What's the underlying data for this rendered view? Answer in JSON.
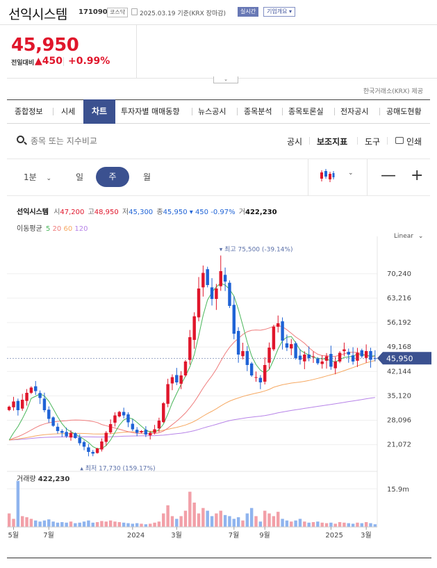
{
  "header": {
    "name": "선익시스템",
    "code": "171090",
    "market": "코스닥",
    "date": "2025.03.19",
    "date_suffix": "기준(KRX 장마감)",
    "realtime": "실시간",
    "corp_info": "기업개요",
    "corp_caret": "▾"
  },
  "quote": {
    "price": "45,950",
    "prev_label": "전일대비",
    "change": "▲450",
    "change_pct": "+0.99%",
    "collapse": "⌄"
  },
  "provider": "한국거래소(KRX) 제공",
  "tabs": [
    "종합정보",
    "시세",
    "차트",
    "투자자별 매매동향",
    "뉴스공시",
    "종목분석",
    "종목토론실",
    "전자공시",
    "공매도현황"
  ],
  "toolbar": {
    "search_placeholder": "종목 또는 지수비교",
    "disclosure": "공시",
    "indicator": "보조지표",
    "tools": "도구",
    "print": "인쇄"
  },
  "periods": {
    "minute": "1분",
    "minute_caret": "⌄",
    "day": "일",
    "week": "주",
    "month": "월",
    "type_caret": "⌄",
    "minus": "—",
    "plus": "+"
  },
  "chart_info": {
    "name": "선익시스템",
    "open_label": "시",
    "open": "47,200",
    "high_label": "고",
    "high": "48,950",
    "low_label": "저",
    "low": "45,300",
    "close_label": "종",
    "close": "45,950",
    "change": "▾ 450",
    "change_pct": "-0.97%",
    "volume_label": "거",
    "volume": "422,230"
  },
  "ma": {
    "label": "이동평균",
    "p5": "5",
    "p20": "20",
    "p60": "60",
    "p120": "120"
  },
  "scale_mode": "Linear",
  "scale_caret": "⌄",
  "annotations": {
    "max": "▾ 최고 75,500 (-39.14%)",
    "min": "▴ 최저 17,730 (159.17%)"
  },
  "volume_panel": {
    "label": "거래량",
    "value": "422,230",
    "axis_tick": "15.9m"
  },
  "colors": {
    "up": "#e0162b",
    "down": "#1f63d6",
    "accent": "#3b5190",
    "ma5": "#49b65a",
    "ma20": "#ef7c7c",
    "ma60": "#f6a861",
    "ma120": "#b783e8"
  },
  "chart_data": {
    "type": "candlestick",
    "y_ticks": [
      "70,240",
      "63,216",
      "56,192",
      "49,168",
      "42,144",
      "35,120",
      "28,096",
      "21,072"
    ],
    "y_tick_values": [
      70240,
      63216,
      56192,
      49168,
      42144,
      35120,
      28096,
      21072
    ],
    "ylim": [
      17000,
      77000
    ],
    "current_price_label": "45,950",
    "current_price": 45950,
    "x_ticks": [
      "5월",
      "7월",
      "2024",
      "3월",
      "7월",
      "9월",
      "2025",
      "3월"
    ],
    "x_tick_index": [
      1,
      9,
      28,
      38,
      51,
      58,
      73,
      81
    ],
    "n_weeks": 84,
    "close": [
      32000,
      33500,
      31000,
      34000,
      36000,
      37500,
      36500,
      34500,
      31000,
      28500,
      26500,
      25000,
      24500,
      23500,
      24500,
      23000,
      21500,
      20500,
      19000,
      18500,
      20000,
      22000,
      24500,
      27000,
      29500,
      30500,
      29500,
      27500,
      25500,
      24500,
      25000,
      24000,
      24500,
      25500,
      28000,
      33000,
      38500,
      40500,
      39000,
      41000,
      45000,
      52000,
      58000,
      66000,
      70500,
      67000,
      63000,
      66000,
      71000,
      68000,
      61000,
      53000,
      47000,
      48000,
      44000,
      41000,
      40500,
      39000,
      44000,
      49000,
      55000,
      56000,
      51000,
      49000,
      50000,
      46000,
      45500,
      47000,
      46000,
      46500,
      44500,
      45000,
      46500,
      43500,
      45000,
      47500,
      48500,
      47000,
      45000,
      47500,
      46500,
      48000,
      45500,
      45950
    ],
    "volume_rel": [
      0.25,
      0.15,
      0.85,
      0.2,
      0.18,
      0.15,
      0.12,
      0.1,
      0.12,
      0.14,
      0.1,
      0.08,
      0.09,
      0.08,
      0.1,
      0.07,
      0.08,
      0.1,
      0.12,
      0.08,
      0.09,
      0.11,
      0.1,
      0.12,
      0.1,
      0.09,
      0.08,
      0.07,
      0.06,
      0.07,
      0.06,
      0.05,
      0.06,
      0.08,
      0.1,
      0.25,
      0.4,
      0.2,
      0.15,
      0.2,
      0.3,
      0.65,
      0.45,
      0.25,
      0.35,
      0.3,
      0.2,
      0.25,
      0.3,
      0.22,
      0.2,
      0.15,
      0.18,
      0.12,
      0.25,
      0.35,
      0.2,
      0.1,
      0.3,
      0.25,
      0.2,
      0.28,
      0.15,
      0.12,
      0.1,
      0.12,
      0.15,
      0.1,
      0.08,
      0.09,
      0.1,
      0.08,
      0.07,
      0.08,
      0.06,
      0.09,
      0.08,
      0.07,
      0.06,
      0.08,
      0.07,
      0.09,
      0.07,
      0.05
    ]
  }
}
